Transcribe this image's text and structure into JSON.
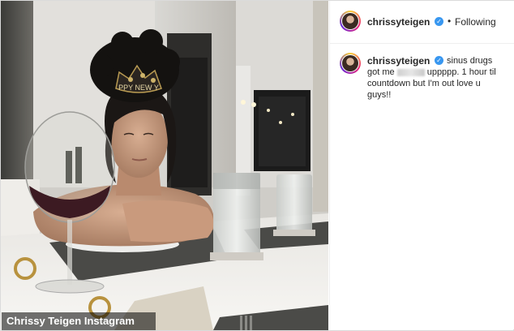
{
  "post": {
    "username": "chrissyteigen",
    "follow_status": "Following",
    "separator": "•",
    "caption_part1": "sinus drugs got me",
    "caption_part2": "uppppp. 1 hour til countdown but I'm out love u guys!!",
    "photo_alt": "Photo of a woman in a HAPPY NEW YEAR crown resting her head on her arms at a dinner table with a wine glass and water glasses"
  },
  "image": {
    "crown_text": "PPY NEW Y",
    "credit": "Chrissy Teigen Instagram"
  },
  "icons": {
    "verified": "verified-badge-icon",
    "avatar": "profile-avatar"
  },
  "colors": {
    "verified": "#3897f0",
    "text": "#262626",
    "border": "#efefef"
  }
}
